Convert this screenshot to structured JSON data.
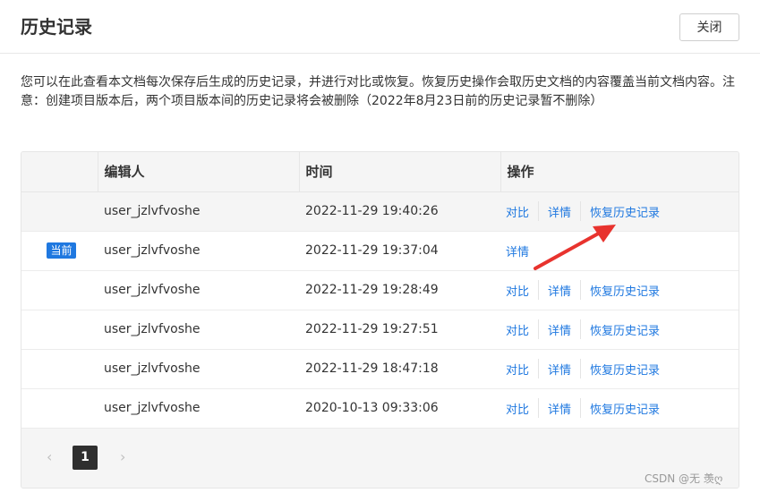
{
  "dialog": {
    "title": "历史记录",
    "close_label": "关闭"
  },
  "description": "您可以在此查看本文档每次保存后生成的历史记录，并进行对比或恢复。恢复历史操作会取历史文档的内容覆盖当前文档内容。注意：创建项目版本后，两个项目版本间的历史记录将会被删除（2022年8月23日前的历史记录暂不删除）",
  "table": {
    "headers": {
      "editor": "编辑人",
      "time": "时间",
      "action": "操作"
    },
    "rows": [
      {
        "badge": "",
        "editor": "user_jzlvfvoshe",
        "time": "2022-11-29 19:40:26",
        "compare": "对比",
        "detail": "详情",
        "restore": "恢复历史记录"
      },
      {
        "badge": "当前",
        "editor": "user_jzlvfvoshe",
        "time": "2022-11-29 19:37:04",
        "compare": "",
        "detail": "详情",
        "restore": ""
      },
      {
        "badge": "",
        "editor": "user_jzlvfvoshe",
        "time": "2022-11-29 19:28:49",
        "compare": "对比",
        "detail": "详情",
        "restore": "恢复历史记录"
      },
      {
        "badge": "",
        "editor": "user_jzlvfvoshe",
        "time": "2022-11-29 19:27:51",
        "compare": "对比",
        "detail": "详情",
        "restore": "恢复历史记录"
      },
      {
        "badge": "",
        "editor": "user_jzlvfvoshe",
        "time": "2022-11-29 18:47:18",
        "compare": "对比",
        "detail": "详情",
        "restore": "恢复历史记录"
      },
      {
        "badge": "",
        "editor": "user_jzlvfvoshe",
        "time": "2020-10-13 09:33:06",
        "compare": "对比",
        "detail": "详情",
        "restore": "恢复历史记录"
      }
    ]
  },
  "pagination": {
    "prev_icon": "chevron-left-icon",
    "current_page": "1",
    "next_icon": "chevron-right-icon"
  },
  "annotation": {
    "arrow_color": "#e8332e"
  },
  "watermark": "CSDN @无 羡ღ"
}
